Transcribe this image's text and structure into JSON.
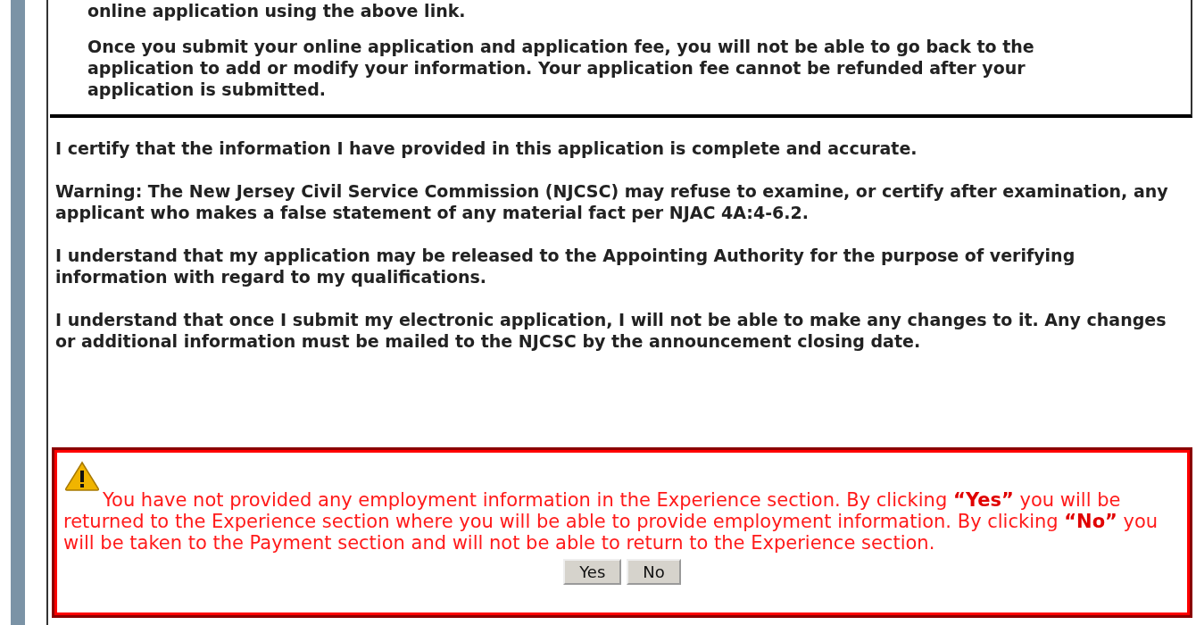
{
  "notice": {
    "paragraphs": [
      "online application using the above link.",
      "Once you submit your online application and application fee, you will not be able to go back to the application to add or modify your information. Your application fee cannot be refunded after your application is submitted."
    ]
  },
  "certification": {
    "paragraphs": [
      "I certify that the information I have provided in this application is complete and accurate.",
      "Warning: The New Jersey Civil Service Commission (NJCSC) may refuse to examine, or certify after examination, any applicant who makes a false statement of any material fact per NJAC 4A:4-6.2.",
      "I understand that my application may be released to the Appointing Authority for the purpose of verifying information with regard to my qualifications.",
      "I understand that once I submit my electronic application, I will not be able to make any changes to it. Any changes or additional information must be mailed to the NJCSC by the announcement closing date."
    ]
  },
  "alert": {
    "message": "You have not provided any employment information in the Experience section. By clicking **“Yes”** you will be returned to the Experience section where you will be able to provide employment information. By clicking **“No”** you will be taken to the Payment section and will not be able to return to the Experience section.",
    "buttons": [
      "Yes",
      "No"
    ]
  }
}
